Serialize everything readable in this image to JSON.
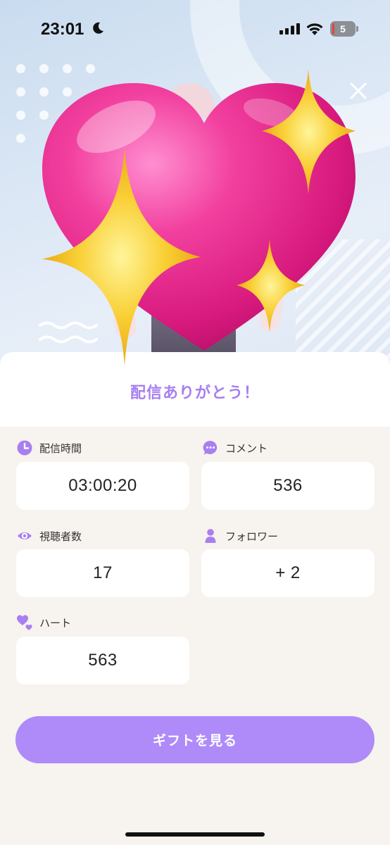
{
  "status_bar": {
    "time": "23:01",
    "battery_level": "5"
  },
  "header": {
    "title": "配信ありがとう！"
  },
  "stats": [
    {
      "key": "duration",
      "label": "配信時間",
      "value": "03:00:20",
      "icon": "clock-icon"
    },
    {
      "key": "comments",
      "label": "コメント",
      "value": "536",
      "icon": "chat-bubble-icon"
    },
    {
      "key": "viewers",
      "label": "視聴者数",
      "value": "17",
      "icon": "eye-icon"
    },
    {
      "key": "followers",
      "label": "フォロワー",
      "value": "+ 2",
      "icon": "person-icon"
    },
    {
      "key": "hearts",
      "label": "ハート",
      "value": "563",
      "icon": "hearts-icon"
    }
  ],
  "actions": {
    "gift_button_label": "ギフトを見る"
  },
  "colors": {
    "accent": "#ae8bf9",
    "title_purple": "#a77ff0",
    "background": "#f7f3ee",
    "heart_pink": "#ec2f8f",
    "sparkle_yellow": "#f7c531"
  }
}
